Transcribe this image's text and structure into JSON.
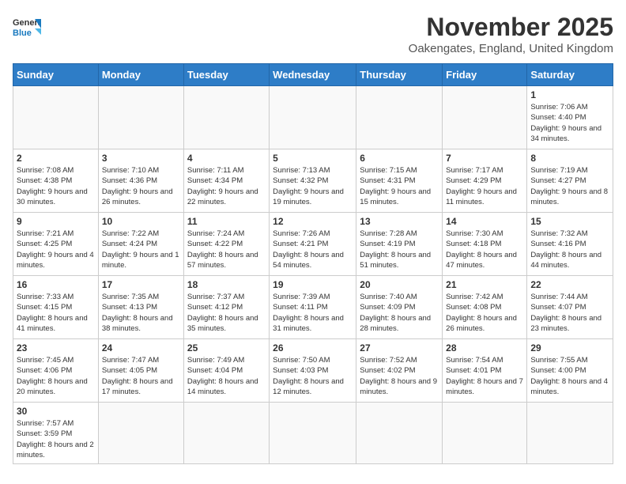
{
  "header": {
    "logo_general": "General",
    "logo_blue": "Blue",
    "month_title": "November 2025",
    "location": "Oakengates, England, United Kingdom"
  },
  "days_of_week": [
    "Sunday",
    "Monday",
    "Tuesday",
    "Wednesday",
    "Thursday",
    "Friday",
    "Saturday"
  ],
  "weeks": [
    [
      {
        "day": "",
        "info": ""
      },
      {
        "day": "",
        "info": ""
      },
      {
        "day": "",
        "info": ""
      },
      {
        "day": "",
        "info": ""
      },
      {
        "day": "",
        "info": ""
      },
      {
        "day": "",
        "info": ""
      },
      {
        "day": "1",
        "info": "Sunrise: 7:06 AM\nSunset: 4:40 PM\nDaylight: 9 hours\nand 34 minutes."
      }
    ],
    [
      {
        "day": "2",
        "info": "Sunrise: 7:08 AM\nSunset: 4:38 PM\nDaylight: 9 hours\nand 30 minutes."
      },
      {
        "day": "3",
        "info": "Sunrise: 7:10 AM\nSunset: 4:36 PM\nDaylight: 9 hours\nand 26 minutes."
      },
      {
        "day": "4",
        "info": "Sunrise: 7:11 AM\nSunset: 4:34 PM\nDaylight: 9 hours\nand 22 minutes."
      },
      {
        "day": "5",
        "info": "Sunrise: 7:13 AM\nSunset: 4:32 PM\nDaylight: 9 hours\nand 19 minutes."
      },
      {
        "day": "6",
        "info": "Sunrise: 7:15 AM\nSunset: 4:31 PM\nDaylight: 9 hours\nand 15 minutes."
      },
      {
        "day": "7",
        "info": "Sunrise: 7:17 AM\nSunset: 4:29 PM\nDaylight: 9 hours\nand 11 minutes."
      },
      {
        "day": "8",
        "info": "Sunrise: 7:19 AM\nSunset: 4:27 PM\nDaylight: 9 hours\nand 8 minutes."
      }
    ],
    [
      {
        "day": "9",
        "info": "Sunrise: 7:21 AM\nSunset: 4:25 PM\nDaylight: 9 hours\nand 4 minutes."
      },
      {
        "day": "10",
        "info": "Sunrise: 7:22 AM\nSunset: 4:24 PM\nDaylight: 9 hours\nand 1 minute."
      },
      {
        "day": "11",
        "info": "Sunrise: 7:24 AM\nSunset: 4:22 PM\nDaylight: 8 hours\nand 57 minutes."
      },
      {
        "day": "12",
        "info": "Sunrise: 7:26 AM\nSunset: 4:21 PM\nDaylight: 8 hours\nand 54 minutes."
      },
      {
        "day": "13",
        "info": "Sunrise: 7:28 AM\nSunset: 4:19 PM\nDaylight: 8 hours\nand 51 minutes."
      },
      {
        "day": "14",
        "info": "Sunrise: 7:30 AM\nSunset: 4:18 PM\nDaylight: 8 hours\nand 47 minutes."
      },
      {
        "day": "15",
        "info": "Sunrise: 7:32 AM\nSunset: 4:16 PM\nDaylight: 8 hours\nand 44 minutes."
      }
    ],
    [
      {
        "day": "16",
        "info": "Sunrise: 7:33 AM\nSunset: 4:15 PM\nDaylight: 8 hours\nand 41 minutes."
      },
      {
        "day": "17",
        "info": "Sunrise: 7:35 AM\nSunset: 4:13 PM\nDaylight: 8 hours\nand 38 minutes."
      },
      {
        "day": "18",
        "info": "Sunrise: 7:37 AM\nSunset: 4:12 PM\nDaylight: 8 hours\nand 35 minutes."
      },
      {
        "day": "19",
        "info": "Sunrise: 7:39 AM\nSunset: 4:11 PM\nDaylight: 8 hours\nand 31 minutes."
      },
      {
        "day": "20",
        "info": "Sunrise: 7:40 AM\nSunset: 4:09 PM\nDaylight: 8 hours\nand 28 minutes."
      },
      {
        "day": "21",
        "info": "Sunrise: 7:42 AM\nSunset: 4:08 PM\nDaylight: 8 hours\nand 26 minutes."
      },
      {
        "day": "22",
        "info": "Sunrise: 7:44 AM\nSunset: 4:07 PM\nDaylight: 8 hours\nand 23 minutes."
      }
    ],
    [
      {
        "day": "23",
        "info": "Sunrise: 7:45 AM\nSunset: 4:06 PM\nDaylight: 8 hours\nand 20 minutes."
      },
      {
        "day": "24",
        "info": "Sunrise: 7:47 AM\nSunset: 4:05 PM\nDaylight: 8 hours\nand 17 minutes."
      },
      {
        "day": "25",
        "info": "Sunrise: 7:49 AM\nSunset: 4:04 PM\nDaylight: 8 hours\nand 14 minutes."
      },
      {
        "day": "26",
        "info": "Sunrise: 7:50 AM\nSunset: 4:03 PM\nDaylight: 8 hours\nand 12 minutes."
      },
      {
        "day": "27",
        "info": "Sunrise: 7:52 AM\nSunset: 4:02 PM\nDaylight: 8 hours\nand 9 minutes."
      },
      {
        "day": "28",
        "info": "Sunrise: 7:54 AM\nSunset: 4:01 PM\nDaylight: 8 hours\nand 7 minutes."
      },
      {
        "day": "29",
        "info": "Sunrise: 7:55 AM\nSunset: 4:00 PM\nDaylight: 8 hours\nand 4 minutes."
      }
    ],
    [
      {
        "day": "30",
        "info": "Sunrise: 7:57 AM\nSunset: 3:59 PM\nDaylight: 8 hours\nand 2 minutes."
      },
      {
        "day": "",
        "info": ""
      },
      {
        "day": "",
        "info": ""
      },
      {
        "day": "",
        "info": ""
      },
      {
        "day": "",
        "info": ""
      },
      {
        "day": "",
        "info": ""
      },
      {
        "day": "",
        "info": ""
      }
    ]
  ]
}
